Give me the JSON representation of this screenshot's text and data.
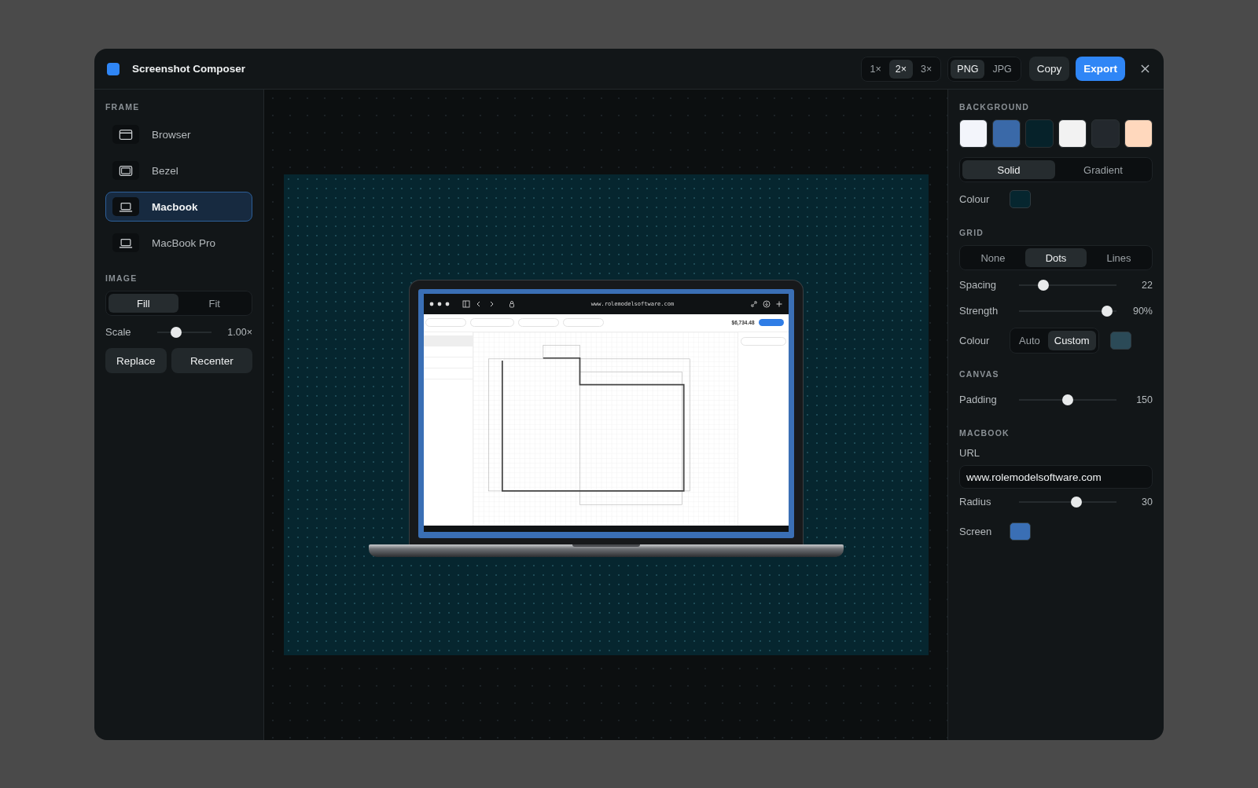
{
  "window": {
    "title": "Screenshot Composer"
  },
  "toolbar": {
    "scales": [
      {
        "label": "1×",
        "selected": false
      },
      {
        "label": "2×",
        "selected": true
      },
      {
        "label": "3×",
        "selected": false
      }
    ],
    "formats": [
      {
        "label": "PNG",
        "selected": true
      },
      {
        "label": "JPG",
        "selected": false
      }
    ],
    "copy": "Copy",
    "export": "Export"
  },
  "sidebar": {
    "frame_heading": "FRAME",
    "frames": [
      {
        "label": "Browser",
        "kind": "browser",
        "selected": false
      },
      {
        "label": "Bezel",
        "kind": "bezel",
        "selected": false
      },
      {
        "label": "Macbook",
        "kind": "laptop",
        "selected": true
      },
      {
        "label": "MacBook Pro",
        "kind": "laptop",
        "selected": false
      }
    ],
    "image_heading": "IMAGE",
    "fit": [
      {
        "label": "Fill",
        "selected": true
      },
      {
        "label": "Fit",
        "selected": false
      }
    ],
    "scale": {
      "label": "Scale",
      "level": 0.3,
      "reading": "1.00×"
    },
    "buttons": [
      "Replace",
      "Recenter"
    ]
  },
  "preview": {
    "url": "www.rolemodelsoftware.com",
    "price": "$6,734.48"
  },
  "panel": {
    "background_heading": "BACKGROUND",
    "swatches": [
      {
        "color": "#f3f5fb"
      },
      {
        "color": "#3a69a8"
      },
      {
        "color": "#06222a"
      },
      {
        "color": "#f2f2f2"
      },
      {
        "color": "#23282d"
      },
      {
        "color": "#ffd8bd"
      }
    ],
    "fill_types": [
      {
        "label": "Solid",
        "selected": true
      },
      {
        "label": "Gradient",
        "selected": false
      }
    ],
    "colour": {
      "label": "Colour",
      "color": "#06262f"
    },
    "grid_heading": "GRID",
    "grid_types": [
      {
        "label": "None",
        "selected": false
      },
      {
        "label": "Dots",
        "selected": true
      },
      {
        "label": "Lines",
        "selected": false
      }
    ],
    "spacing": {
      "label": "Spacing",
      "level": 0.22,
      "reading": "22"
    },
    "strength": {
      "label": "Strength",
      "level": 0.95,
      "reading": "90%"
    },
    "grid_colour": {
      "label": "Colour",
      "modes": [
        {
          "label": "Auto",
          "selected": false
        },
        {
          "label": "Custom",
          "selected": true
        }
      ],
      "color": "#2b4a57"
    },
    "canvas_heading": "CANVAS",
    "padding": {
      "label": "Padding",
      "level": 0.5,
      "reading": "150"
    },
    "macbook_heading": "MACBOOK",
    "url": {
      "label": "URL",
      "value": "www.rolemodelsoftware.com"
    },
    "radius": {
      "label": "Radius",
      "level": 0.6,
      "reading": "30"
    },
    "screen": {
      "label": "Screen",
      "color": "#3a6fb5"
    }
  }
}
